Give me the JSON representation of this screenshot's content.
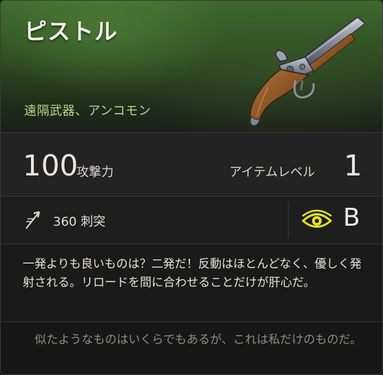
{
  "item": {
    "name": "ピストル",
    "type_rarity": "遠隔武器、アンコモン",
    "attack_value": "100",
    "attack_label": "攻撃力",
    "level_label": "アイテムレベル",
    "level_value": "1",
    "damage_value_type": "360 刺突",
    "damage_icon": "pierce-arrow-icon",
    "perception_icon": "eye-icon",
    "grade": "B",
    "description": "一発よりも良いものは？二発だ！反動はほとんどなく、優しく発射される。リロードを間に合わせることだけが肝心だ。",
    "flavor": "似たようなものはいくらでもあるが、これは私だけのものだ。"
  },
  "colors": {
    "subtitle": "#b7d88c",
    "eye_icon": "#e3e02a",
    "header_green": "#3e6a2c"
  }
}
